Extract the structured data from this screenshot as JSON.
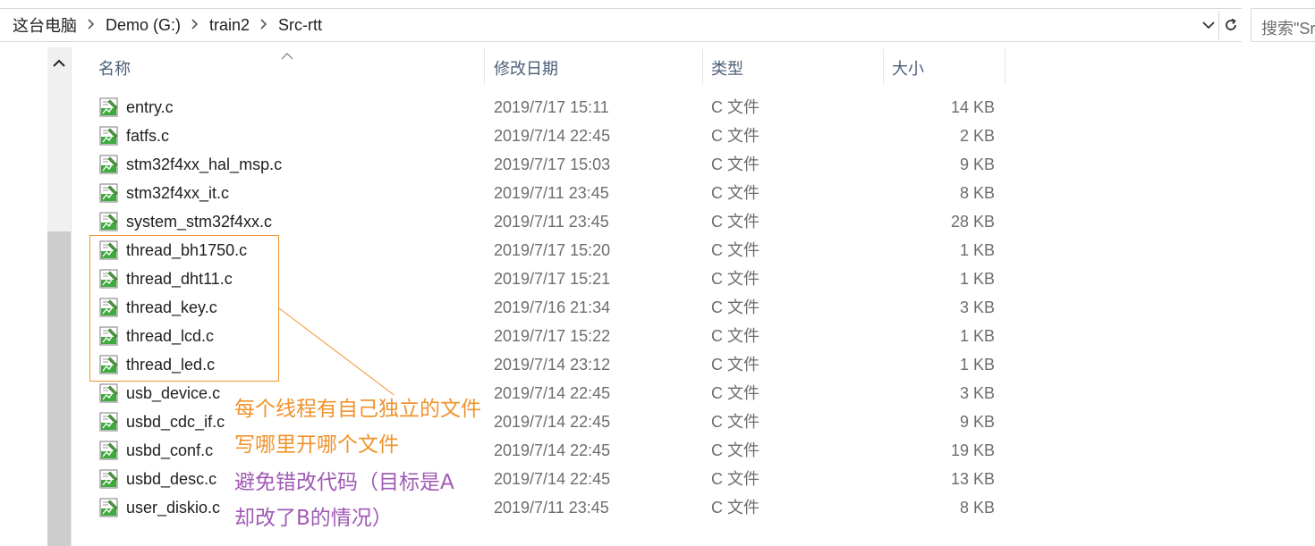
{
  "address_bar": {
    "breadcrumbs": [
      "这台电脑",
      "Demo (G:)",
      "train2",
      "Src-rtt"
    ],
    "dropdown_icon": "chevron-down-icon",
    "refresh_icon": "refresh-icon"
  },
  "search": {
    "placeholder": "搜索\"Sr"
  },
  "columns": {
    "name": "名称",
    "date": "修改日期",
    "type": "类型",
    "size": "大小"
  },
  "files": [
    {
      "name": "entry.c",
      "date": "2019/7/17 15:11",
      "type": "C 文件",
      "size": "14 KB"
    },
    {
      "name": "fatfs.c",
      "date": "2019/7/14 22:45",
      "type": "C 文件",
      "size": "2 KB"
    },
    {
      "name": "stm32f4xx_hal_msp.c",
      "date": "2019/7/17 15:03",
      "type": "C 文件",
      "size": "9 KB"
    },
    {
      "name": "stm32f4xx_it.c",
      "date": "2019/7/11 23:45",
      "type": "C 文件",
      "size": "8 KB"
    },
    {
      "name": "system_stm32f4xx.c",
      "date": "2019/7/11 23:45",
      "type": "C 文件",
      "size": "28 KB"
    },
    {
      "name": "thread_bh1750.c",
      "date": "2019/7/17 15:20",
      "type": "C 文件",
      "size": "1 KB"
    },
    {
      "name": "thread_dht11.c",
      "date": "2019/7/17 15:21",
      "type": "C 文件",
      "size": "1 KB"
    },
    {
      "name": "thread_key.c",
      "date": "2019/7/16 21:34",
      "type": "C 文件",
      "size": "3 KB"
    },
    {
      "name": "thread_lcd.c",
      "date": "2019/7/17 15:22",
      "type": "C 文件",
      "size": "1 KB"
    },
    {
      "name": "thread_led.c",
      "date": "2019/7/14 23:12",
      "type": "C 文件",
      "size": "1 KB"
    },
    {
      "name": "usb_device.c",
      "date": "2019/7/14 22:45",
      "type": "C 文件",
      "size": "3 KB"
    },
    {
      "name": "usbd_cdc_if.c",
      "date": "2019/7/14 22:45",
      "type": "C 文件",
      "size": "9 KB"
    },
    {
      "name": "usbd_conf.c",
      "date": "2019/7/14 22:45",
      "type": "C 文件",
      "size": "19 KB"
    },
    {
      "name": "usbd_desc.c",
      "date": "2019/7/14 22:45",
      "type": "C 文件",
      "size": "13 KB"
    },
    {
      "name": "user_diskio.c",
      "date": "2019/7/11 23:45",
      "type": "C 文件",
      "size": "8 KB"
    }
  ],
  "annotations": {
    "line1": "每个线程有自己独立的文件",
    "line2": "写哪里开哪个文件",
    "line3": "避免错改代码（目标是A",
    "line4": "却改了B的情况）",
    "orange": "#f0932b",
    "purple": "#a05ab4"
  },
  "icons": {
    "file": "c-source-file-icon"
  }
}
